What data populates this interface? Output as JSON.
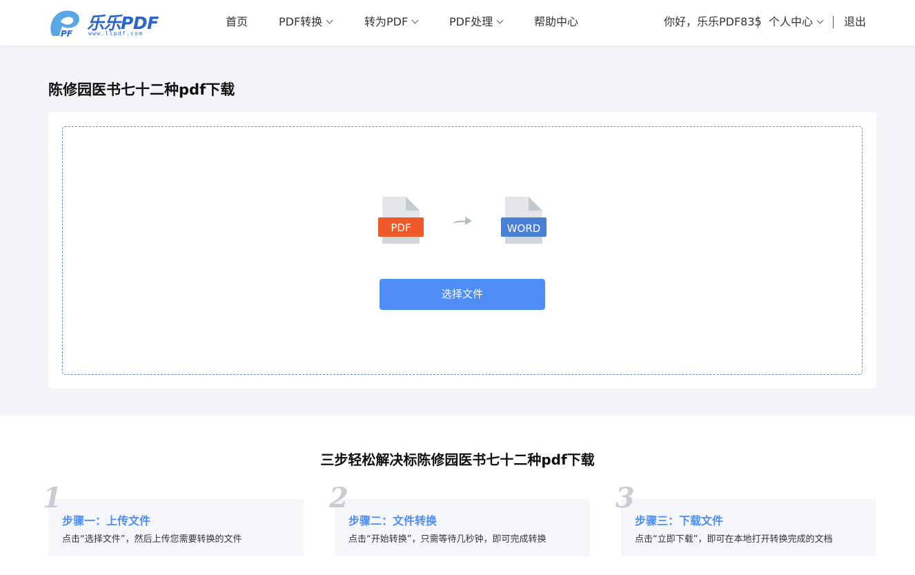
{
  "header": {
    "logo_text": "乐乐PDF",
    "logo_url": "www.llpdf.com",
    "nav": [
      {
        "label": "首页"
      },
      {
        "label": "PDF转换"
      },
      {
        "label": "转为PDF"
      },
      {
        "label": "PDF处理"
      },
      {
        "label": "帮助中心"
      }
    ],
    "greeting": "你好，乐乐PDF835",
    "user_center": "个人中心",
    "logout": "退出"
  },
  "main": {
    "title": "陈修园医书七十二种pdf下载",
    "source_icon_label": "PDF",
    "target_icon_label": "WORD",
    "select_button": "选择文件"
  },
  "steps": {
    "title": "三步轻松解决标陈修园医书七十二种pdf下载",
    "items": [
      {
        "number": "1",
        "heading": "步骤一：上传文件",
        "desc": "点击“选择文件”，然后上传您需要转换的文件"
      },
      {
        "number": "2",
        "heading": "步骤二：文件转换",
        "desc": "点击“开始转换”，只需等待几秒钟，即可完成转换"
      },
      {
        "number": "3",
        "heading": "步骤三：下载文件",
        "desc": "点击“立即下载”，即可在本地打开转换完成的文档"
      }
    ]
  },
  "colors": {
    "brand": "#2b66c8",
    "accent": "#4e8ef4",
    "pdf_red": "#f05a28",
    "word_blue": "#4a7fd6",
    "page_bg": "#f3f4f7"
  }
}
